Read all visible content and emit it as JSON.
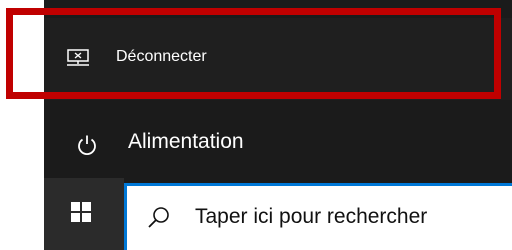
{
  "menu": {
    "disconnect": {
      "label": "Déconnecter",
      "icon": "disconnect-icon"
    },
    "power": {
      "label": "Alimentation",
      "icon": "power-icon"
    }
  },
  "taskbar": {
    "start_icon": "windows-logo-icon",
    "search": {
      "placeholder": "Taper ici pour rechercher",
      "icon": "search-icon"
    }
  },
  "colors": {
    "highlight": "#c00000",
    "accent": "#0078d7",
    "menu_bg": "#1b1b1b"
  }
}
